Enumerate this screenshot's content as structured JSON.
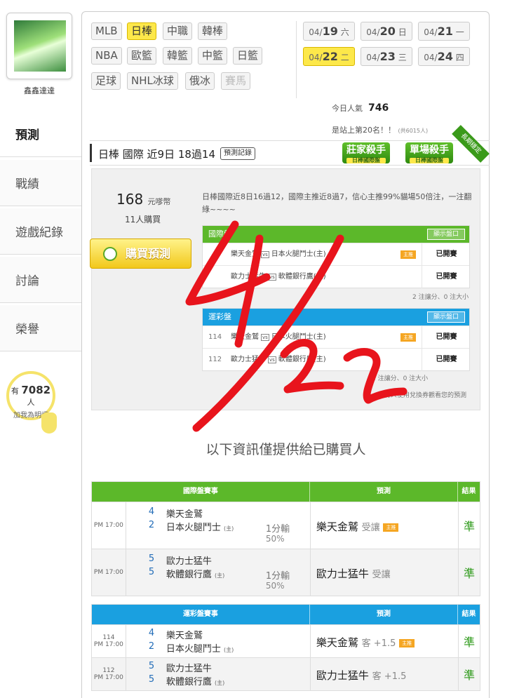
{
  "sidebar": {
    "username": "鑫鑫達達",
    "items": [
      {
        "label": "預測",
        "active": true
      },
      {
        "label": "戰績",
        "active": false
      },
      {
        "label": "遊戲紀錄",
        "active": false
      },
      {
        "label": "討論",
        "active": false
      },
      {
        "label": "榮譽",
        "active": false
      }
    ],
    "fans": {
      "prefix": "有",
      "count": "7082",
      "suffix": "人",
      "label": "加我為明燈"
    }
  },
  "categories": {
    "row1": [
      "MLB",
      "日棒",
      "中職",
      "韓棒"
    ],
    "row2": [
      "NBA",
      "歐籃",
      "韓籃",
      "中籃",
      "日籃"
    ],
    "row3": [
      "足球",
      "NHL冰球",
      "俄冰",
      "賽馬"
    ],
    "active": "日棒"
  },
  "dates": [
    {
      "md": "04/",
      "day": "19",
      "wd": "六"
    },
    {
      "md": "04/",
      "day": "20",
      "wd": "日"
    },
    {
      "md": "04/",
      "day": "21",
      "wd": "一"
    },
    {
      "md": "04/",
      "day": "22",
      "wd": "二"
    },
    {
      "md": "04/",
      "day": "23",
      "wd": "三"
    },
    {
      "md": "04/",
      "day": "24",
      "wd": "四"
    }
  ],
  "active_date": "22",
  "popularity": {
    "label": "今日人氣",
    "value": "746"
  },
  "rank_text": "是站上第20名！！",
  "rank_total": "(共6015人)",
  "header": {
    "title": "日棒 國際 近9日 18過14",
    "record_button": "預測記錄"
  },
  "badges": [
    {
      "title": "莊家殺手",
      "sub": "日棒國際盤"
    },
    {
      "title": "單場殺手",
      "sub": "日棒國際盤"
    }
  ],
  "ribbon": "長期穩定",
  "purchase": {
    "price": "168",
    "unit": "元嗲幣",
    "buyers": "11人購買",
    "button": "購買預測"
  },
  "description": "日棒國際近8日16過12，國際主推近8過7，信心主推99%貓場50倍注，一注翻綠~~~~",
  "intl_preview": {
    "title": "國際盤",
    "show_button": "顯示盤口",
    "rows": [
      {
        "no": "",
        "home": "樂天金鷲",
        "away": "日本火腿鬥士(主)",
        "tag": "主推",
        "status": "已開賽"
      },
      {
        "no": "",
        "home": "歐力士猛牛",
        "away": "軟體銀行鷹(主)",
        "tag": "",
        "status": "已開賽"
      }
    ],
    "summary": "2 注讓分、0 注大小"
  },
  "lottery_preview": {
    "title": "運彩盤",
    "show_button": "顯示盤口",
    "rows": [
      {
        "no": "114",
        "home": "樂天金鷲",
        "away": "日本火腿鬥士(主)",
        "tag": "主推",
        "status": "已開賽"
      },
      {
        "no": "112",
        "home": "歐力士猛牛",
        "away": "軟體銀行鷹(主)",
        "tag": "",
        "status": "已開賽"
      }
    ],
    "summary": "2 注讓分、0 注大小",
    "note": "有人使用兌換券觀看您的預測"
  },
  "vs_label": "vs",
  "notice": "以下資訊僅提供給已購買人",
  "intl_table": {
    "headers": [
      "國際盤賽事",
      "預測",
      "結果"
    ],
    "color": "#5cb82a",
    "rows": [
      {
        "time": "PM 17:00",
        "s1": "4",
        "s2": "2",
        "t1": "樂天金鷲",
        "t2": "日本火腿鬥士",
        "home_mark": "(主)",
        "line": "1分輸",
        "pct": "50%",
        "pred": "樂天金鷲",
        "pred_note": "受讓",
        "tag": "主推",
        "result": "準"
      },
      {
        "time": "PM 17:00",
        "s1": "5",
        "s2": "5",
        "t1": "歐力士猛牛",
        "t2": "軟體銀行鷹",
        "home_mark": "(主)",
        "line": "1分輸",
        "pct": "50%",
        "pred": "歐力士猛牛",
        "pred_note": "受讓",
        "tag": "",
        "result": "準"
      }
    ]
  },
  "lottery_table": {
    "headers": [
      "運彩盤賽事",
      "預測",
      "結果"
    ],
    "color": "#1aa0e0",
    "rows": [
      {
        "no": "114",
        "time": "PM 17:00",
        "s1": "4",
        "s2": "2",
        "t1": "樂天金鷲",
        "t2": "日本火腿鬥士",
        "home_mark": "(主)",
        "pred": "樂天金鷲",
        "pred_note": "客 +1.5",
        "tag": "主推",
        "result": "準"
      },
      {
        "no": "112",
        "time": "PM 17:00",
        "s1": "5",
        "s2": "5",
        "t1": "歐力士猛牛",
        "t2": "軟體銀行鷹",
        "home_mark": "(主)",
        "pred": "歐力士猛牛",
        "pred_note": "客 +1.5",
        "tag": "",
        "result": "準"
      }
    ]
  },
  "colors": {
    "accent_yellow": "#fde84a",
    "green": "#5cb82a",
    "blue": "#1aa0e0",
    "scrawl": "#e8141c"
  }
}
